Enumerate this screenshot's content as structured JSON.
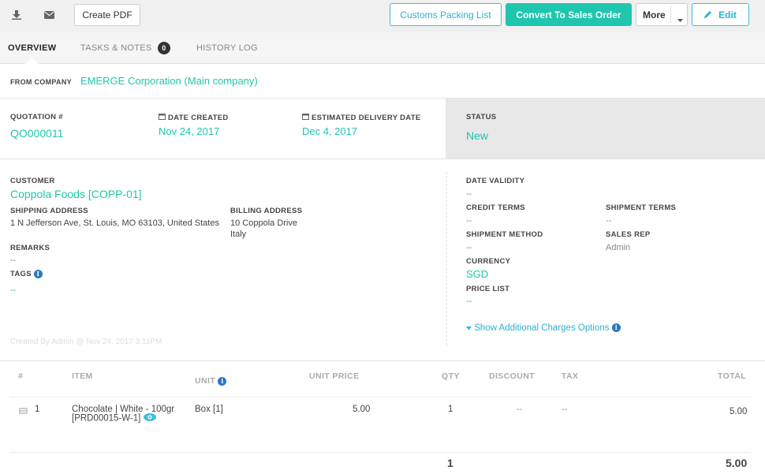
{
  "toolbar": {
    "download_icon": "download-icon",
    "email_icon": "envelope-icon",
    "create_pdf": "Create PDF",
    "customs_packing_list": "Customs Packing List",
    "convert_to_sales_order": "Convert To Sales Order",
    "more": "More",
    "edit": "Edit"
  },
  "tabs": [
    {
      "label": "OVERVIEW",
      "active": true
    },
    {
      "label": "TASKS & NOTES",
      "badge": "0"
    },
    {
      "label": "HISTORY LOG"
    }
  ],
  "from_company": {
    "label": "FROM COMPANY",
    "value": "EMERGE Corporation (Main company)"
  },
  "summary": {
    "quotation_label": "QUOTATION #",
    "quotation_value": "QO000011",
    "date_created_label": "DATE CREATED",
    "date_created_value": "Nov 24, 2017",
    "est_delivery_label": "ESTIMATED DELIVERY DATE",
    "est_delivery_value": "Dec 4, 2017",
    "status_label": "STATUS",
    "status_value": "New"
  },
  "customer": {
    "label": "CUSTOMER",
    "value": "Coppola Foods [COPP-01]",
    "shipping_label": "SHIPPING ADDRESS",
    "shipping_value": "1 N Jefferson Ave, St. Louis, MO 63103, United States",
    "billing_label": "BILLING ADDRESS",
    "billing_line1": "10 Coppola Drive",
    "billing_line2": "Italy",
    "remarks_label": "REMARKS",
    "remarks_value": "--",
    "tags_label": "TAGS",
    "tags_value": "--",
    "created_by": "Created By Admin @ Nov 24, 2017 3:11PM"
  },
  "details": {
    "date_validity_label": "DATE VALIDITY",
    "date_validity_value": "--",
    "credit_terms_label": "CREDIT TERMS",
    "credit_terms_value": "--",
    "shipment_terms_label": "SHIPMENT TERMS",
    "shipment_terms_value": "--",
    "shipment_method_label": "SHIPMENT METHOD",
    "shipment_method_value": "--",
    "sales_rep_label": "SALES REP",
    "sales_rep_value": "Admin",
    "currency_label": "CURRENCY",
    "currency_value": "SGD",
    "price_list_label": "PRICE LIST",
    "price_list_value": "--",
    "additional_charges": "Show Additional Charges Options"
  },
  "table": {
    "headers": {
      "num": "#",
      "item": "ITEM",
      "unit": "UNIT",
      "unit_price": "UNIT PRICE",
      "qty": "QTY",
      "discount": "DISCOUNT",
      "tax": "TAX",
      "total": "TOTAL"
    },
    "rows": [
      {
        "num": "1",
        "item_line1": "Chocolate | White - 100gr",
        "item_line2": "[PRD00015-W-1]",
        "unit": "Box [1]",
        "unit_price": "5.00",
        "qty": "1",
        "discount": "--",
        "tax": "--",
        "total": "5.00"
      }
    ],
    "footer": {
      "qty": "1",
      "total": "5.00"
    }
  }
}
